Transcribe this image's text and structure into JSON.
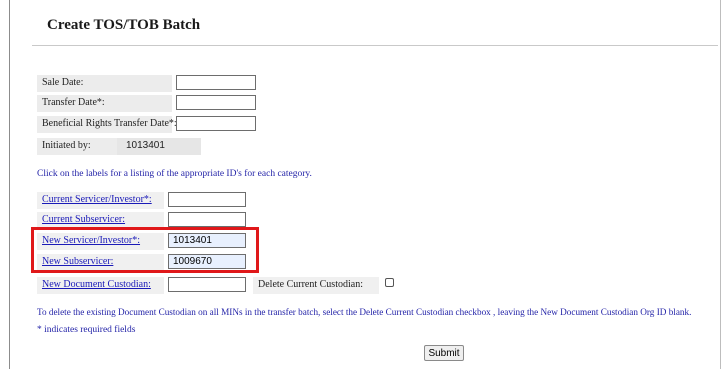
{
  "page": {
    "title": "Create TOS/TOB Batch"
  },
  "dates": {
    "sale_date_label": "Sale Date:",
    "transfer_date_label": "Transfer Date*:",
    "beneficial_label": "Beneficial Rights Transfer Date*:",
    "initiated_by_label": "Initiated by:",
    "initiated_by_value": "1013401"
  },
  "hint": "Click on the labels for a listing of the appropriate ID's for each category.",
  "orgs": {
    "current_servicer_label": "Current Servicer/Investor*:",
    "current_subservicer_label": "Current Subservicer:",
    "new_servicer_label": "New Servicer/Investor*:",
    "new_servicer_value": "1013401",
    "new_subservicer_label": "New Subservicer:",
    "new_subservicer_value": "1009670",
    "new_custodian_label": "New Document Custodian:",
    "delete_custodian_label": "Delete Current Custodian:"
  },
  "instructions": "To delete the existing Document Custodian on all MINs in the transfer batch, select the Delete Current Custodian checkbox , leaving the New Document Custodian Org ID blank.",
  "required_note": "* indicates required fields",
  "submit_label": "Submit",
  "colors": {
    "link": "#1a1ab8",
    "highlight": "#e0181a",
    "autofill": "#e8f0fe"
  }
}
